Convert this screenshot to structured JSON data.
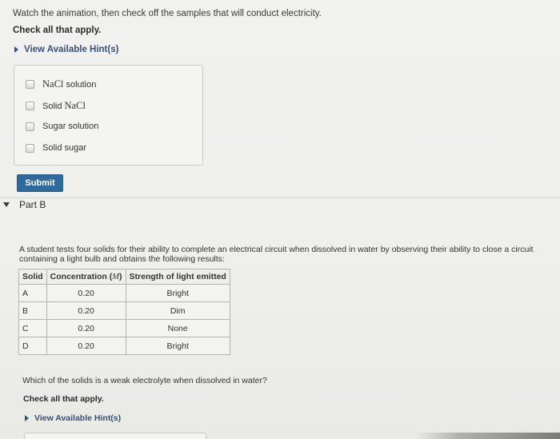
{
  "part_a": {
    "instructions": "Watch the animation, then check off the samples that will conduct electricity.",
    "check_all": "Check all that apply.",
    "hint_link": "View Available Hint(s)",
    "options": [
      {
        "formula": "NaCl",
        "text": " solution"
      },
      {
        "prefix": "Solid ",
        "formula": "NaCl"
      },
      {
        "text": "Sugar solution"
      },
      {
        "text": "Solid sugar"
      }
    ],
    "submit_label": "Submit"
  },
  "part_b": {
    "title": "Part B",
    "problem_text": "A student tests four solids for their ability to complete an electrical circuit when dissolved in water by observing their ability to close a circuit containing a light bulb and obtains the following results:",
    "table": {
      "headers": {
        "solid": "Solid",
        "conc_prefix": "Concentration (",
        "conc_var": "M",
        "conc_suffix": ")",
        "strength": "Strength of light emitted"
      },
      "rows": [
        {
          "solid": "A",
          "concentration": "0.20",
          "strength": "Bright"
        },
        {
          "solid": "B",
          "concentration": "0.20",
          "strength": "Dim"
        },
        {
          "solid": "C",
          "concentration": "0.20",
          "strength": "None"
        },
        {
          "solid": "D",
          "concentration": "0.20",
          "strength": "Bright"
        }
      ]
    },
    "question": "Which of the solids is a weak electrolyte when dissolved in water?",
    "check_all": "Check all that apply.",
    "hint_link": "View Available Hint(s)"
  },
  "colors": {
    "link": "#37507a",
    "submit_bg": "#2f6a9c",
    "background": "#f1f1ef"
  }
}
